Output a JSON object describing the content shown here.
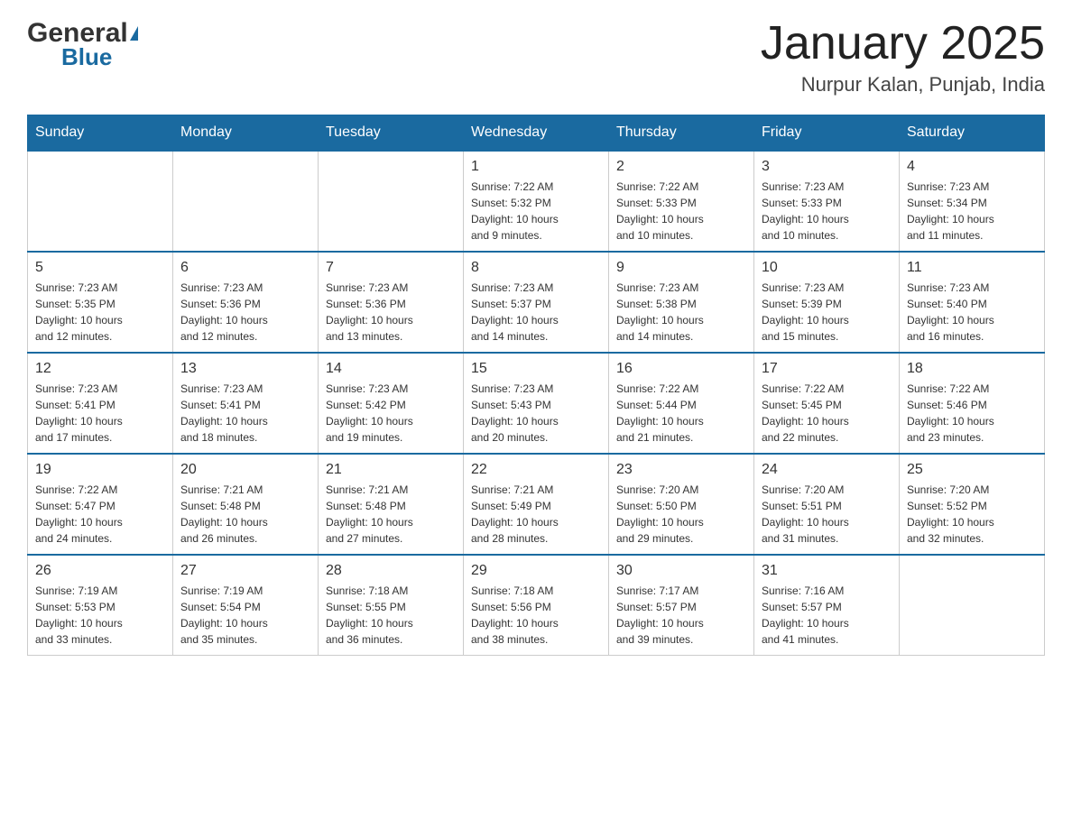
{
  "header": {
    "logo_general": "General",
    "logo_blue": "Blue",
    "title": "January 2025",
    "subtitle": "Nurpur Kalan, Punjab, India"
  },
  "days_of_week": [
    "Sunday",
    "Monday",
    "Tuesday",
    "Wednesday",
    "Thursday",
    "Friday",
    "Saturday"
  ],
  "weeks": [
    [
      {
        "day": "",
        "info": ""
      },
      {
        "day": "",
        "info": ""
      },
      {
        "day": "",
        "info": ""
      },
      {
        "day": "1",
        "info": "Sunrise: 7:22 AM\nSunset: 5:32 PM\nDaylight: 10 hours\nand 9 minutes."
      },
      {
        "day": "2",
        "info": "Sunrise: 7:22 AM\nSunset: 5:33 PM\nDaylight: 10 hours\nand 10 minutes."
      },
      {
        "day": "3",
        "info": "Sunrise: 7:23 AM\nSunset: 5:33 PM\nDaylight: 10 hours\nand 10 minutes."
      },
      {
        "day": "4",
        "info": "Sunrise: 7:23 AM\nSunset: 5:34 PM\nDaylight: 10 hours\nand 11 minutes."
      }
    ],
    [
      {
        "day": "5",
        "info": "Sunrise: 7:23 AM\nSunset: 5:35 PM\nDaylight: 10 hours\nand 12 minutes."
      },
      {
        "day": "6",
        "info": "Sunrise: 7:23 AM\nSunset: 5:36 PM\nDaylight: 10 hours\nand 12 minutes."
      },
      {
        "day": "7",
        "info": "Sunrise: 7:23 AM\nSunset: 5:36 PM\nDaylight: 10 hours\nand 13 minutes."
      },
      {
        "day": "8",
        "info": "Sunrise: 7:23 AM\nSunset: 5:37 PM\nDaylight: 10 hours\nand 14 minutes."
      },
      {
        "day": "9",
        "info": "Sunrise: 7:23 AM\nSunset: 5:38 PM\nDaylight: 10 hours\nand 14 minutes."
      },
      {
        "day": "10",
        "info": "Sunrise: 7:23 AM\nSunset: 5:39 PM\nDaylight: 10 hours\nand 15 minutes."
      },
      {
        "day": "11",
        "info": "Sunrise: 7:23 AM\nSunset: 5:40 PM\nDaylight: 10 hours\nand 16 minutes."
      }
    ],
    [
      {
        "day": "12",
        "info": "Sunrise: 7:23 AM\nSunset: 5:41 PM\nDaylight: 10 hours\nand 17 minutes."
      },
      {
        "day": "13",
        "info": "Sunrise: 7:23 AM\nSunset: 5:41 PM\nDaylight: 10 hours\nand 18 minutes."
      },
      {
        "day": "14",
        "info": "Sunrise: 7:23 AM\nSunset: 5:42 PM\nDaylight: 10 hours\nand 19 minutes."
      },
      {
        "day": "15",
        "info": "Sunrise: 7:23 AM\nSunset: 5:43 PM\nDaylight: 10 hours\nand 20 minutes."
      },
      {
        "day": "16",
        "info": "Sunrise: 7:22 AM\nSunset: 5:44 PM\nDaylight: 10 hours\nand 21 minutes."
      },
      {
        "day": "17",
        "info": "Sunrise: 7:22 AM\nSunset: 5:45 PM\nDaylight: 10 hours\nand 22 minutes."
      },
      {
        "day": "18",
        "info": "Sunrise: 7:22 AM\nSunset: 5:46 PM\nDaylight: 10 hours\nand 23 minutes."
      }
    ],
    [
      {
        "day": "19",
        "info": "Sunrise: 7:22 AM\nSunset: 5:47 PM\nDaylight: 10 hours\nand 24 minutes."
      },
      {
        "day": "20",
        "info": "Sunrise: 7:21 AM\nSunset: 5:48 PM\nDaylight: 10 hours\nand 26 minutes."
      },
      {
        "day": "21",
        "info": "Sunrise: 7:21 AM\nSunset: 5:48 PM\nDaylight: 10 hours\nand 27 minutes."
      },
      {
        "day": "22",
        "info": "Sunrise: 7:21 AM\nSunset: 5:49 PM\nDaylight: 10 hours\nand 28 minutes."
      },
      {
        "day": "23",
        "info": "Sunrise: 7:20 AM\nSunset: 5:50 PM\nDaylight: 10 hours\nand 29 minutes."
      },
      {
        "day": "24",
        "info": "Sunrise: 7:20 AM\nSunset: 5:51 PM\nDaylight: 10 hours\nand 31 minutes."
      },
      {
        "day": "25",
        "info": "Sunrise: 7:20 AM\nSunset: 5:52 PM\nDaylight: 10 hours\nand 32 minutes."
      }
    ],
    [
      {
        "day": "26",
        "info": "Sunrise: 7:19 AM\nSunset: 5:53 PM\nDaylight: 10 hours\nand 33 minutes."
      },
      {
        "day": "27",
        "info": "Sunrise: 7:19 AM\nSunset: 5:54 PM\nDaylight: 10 hours\nand 35 minutes."
      },
      {
        "day": "28",
        "info": "Sunrise: 7:18 AM\nSunset: 5:55 PM\nDaylight: 10 hours\nand 36 minutes."
      },
      {
        "day": "29",
        "info": "Sunrise: 7:18 AM\nSunset: 5:56 PM\nDaylight: 10 hours\nand 38 minutes."
      },
      {
        "day": "30",
        "info": "Sunrise: 7:17 AM\nSunset: 5:57 PM\nDaylight: 10 hours\nand 39 minutes."
      },
      {
        "day": "31",
        "info": "Sunrise: 7:16 AM\nSunset: 5:57 PM\nDaylight: 10 hours\nand 41 minutes."
      },
      {
        "day": "",
        "info": ""
      }
    ]
  ],
  "colors": {
    "header_bg": "#1a6aa0",
    "header_text": "#ffffff",
    "border": "#cccccc",
    "text": "#333333"
  }
}
